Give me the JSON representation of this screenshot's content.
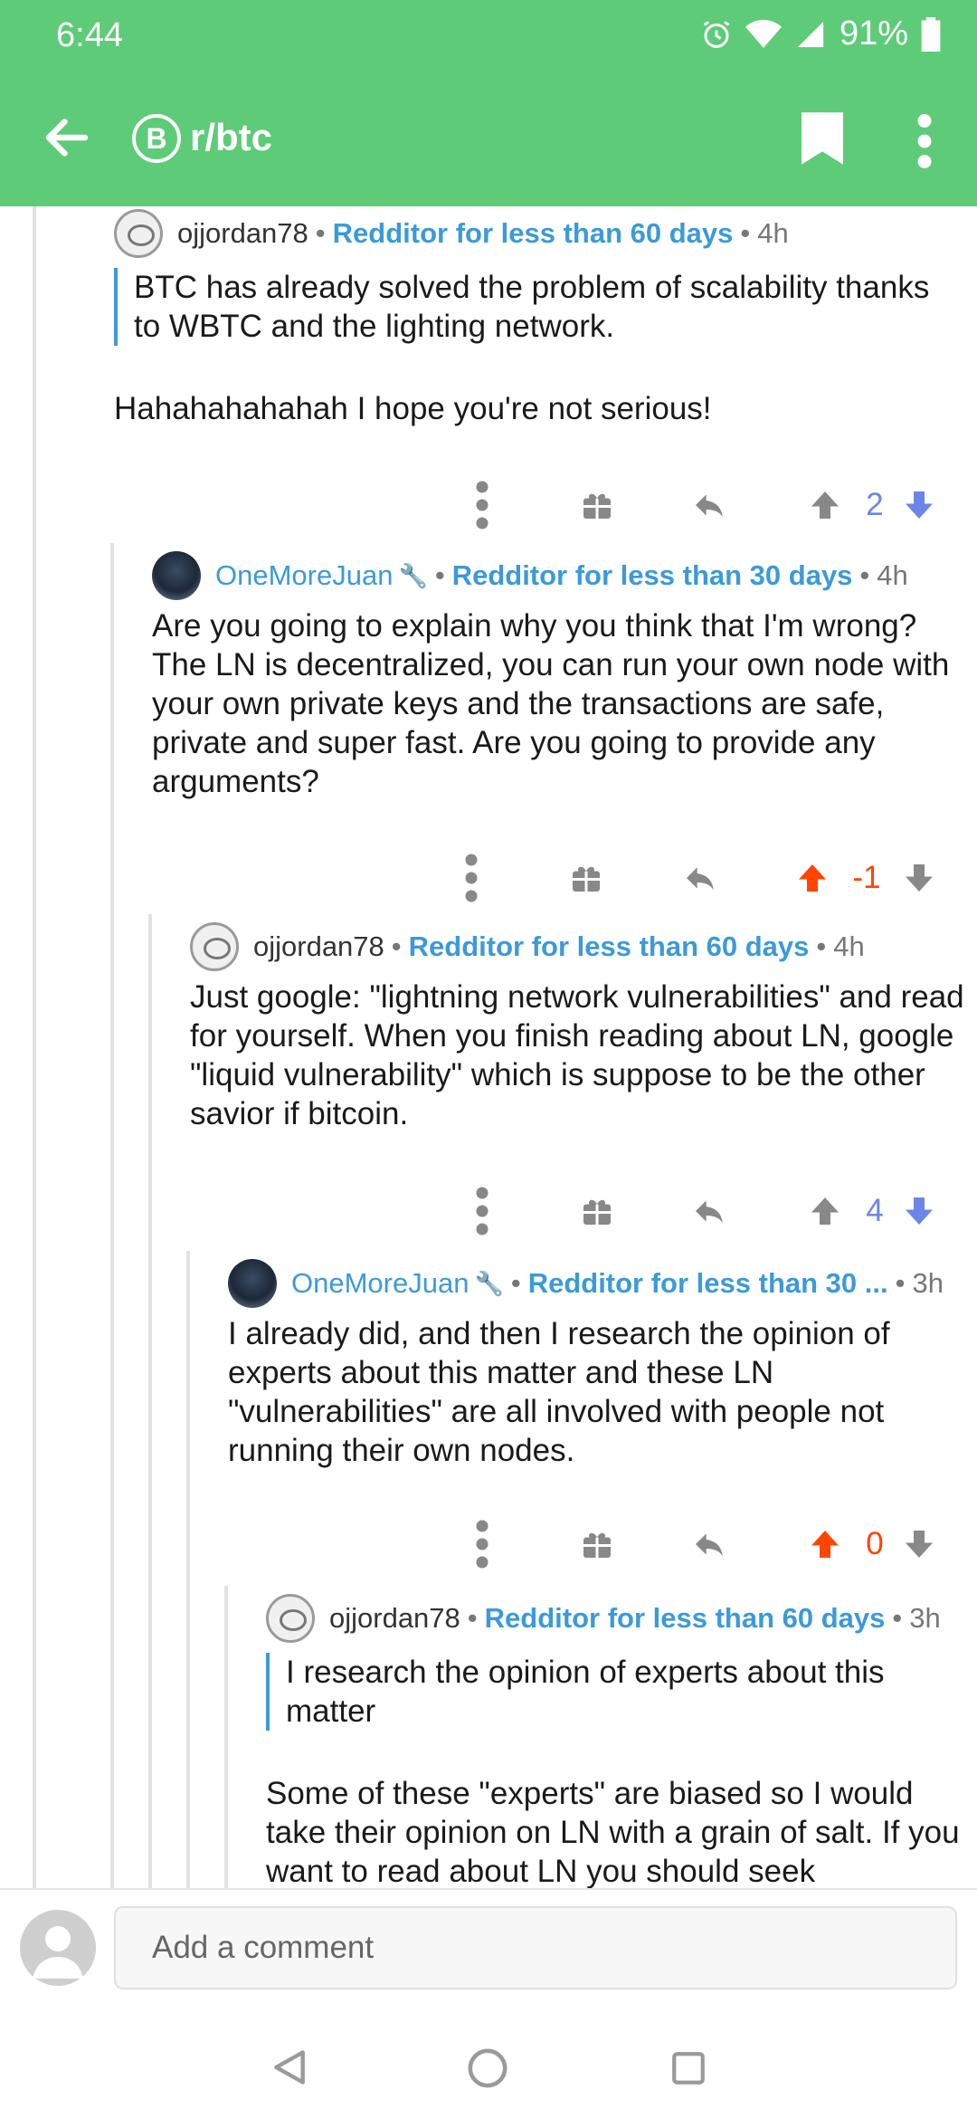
{
  "status": {
    "time": "6:44",
    "battery": "91%"
  },
  "appbar": {
    "subreddit": "r/btc",
    "sub_icon_letter": "B",
    "accent": "#5ecb78"
  },
  "comments": [
    {
      "username": "ojjordan78",
      "flair": "Redditor for less than 60 days",
      "age": "4h",
      "quote": "BTC has already solved the problem of scalability thanks to WBTC and the lighting network.",
      "body": "Hahahahahahah I hope you're not serious!",
      "score": "2"
    },
    {
      "username": "OneMoreJuan",
      "flair": "Redditor for less than 30 days",
      "age": "4h",
      "body": "Are you going to explain why you think that I'm wrong? The LN is decentralized, you can run your own node with your own private keys and the transactions are safe, private and super fast. Are you going to provide any arguments?",
      "score": "-1"
    },
    {
      "username": "ojjordan78",
      "flair": "Redditor for less than 60 days",
      "age": "4h",
      "body": "Just google: \"lightning network vulnerabilities\" and read for yourself. When you finish reading about LN, google \"liquid vulnerability\" which is suppose to be the other savior if bitcoin.",
      "score": "4"
    },
    {
      "username": "OneMoreJuan",
      "flair": "Redditor for less than 30 ...",
      "age": "3h",
      "body": "I already did, and then I research the opinion of experts about this matter and these LN \"vulnerabilities\" are all involved with people not running their own nodes.",
      "score": "0"
    },
    {
      "username": "ojjordan78",
      "flair": "Redditor for less than 60 days",
      "age": "3h",
      "quote": "I research the opinion of experts about this matter",
      "body": "Some of these \"experts\" are biased so I would take their opinion on LN with a grain of salt. If you want to read about LN you should seek"
    }
  ],
  "composer": {
    "placeholder": "Add a comment"
  }
}
